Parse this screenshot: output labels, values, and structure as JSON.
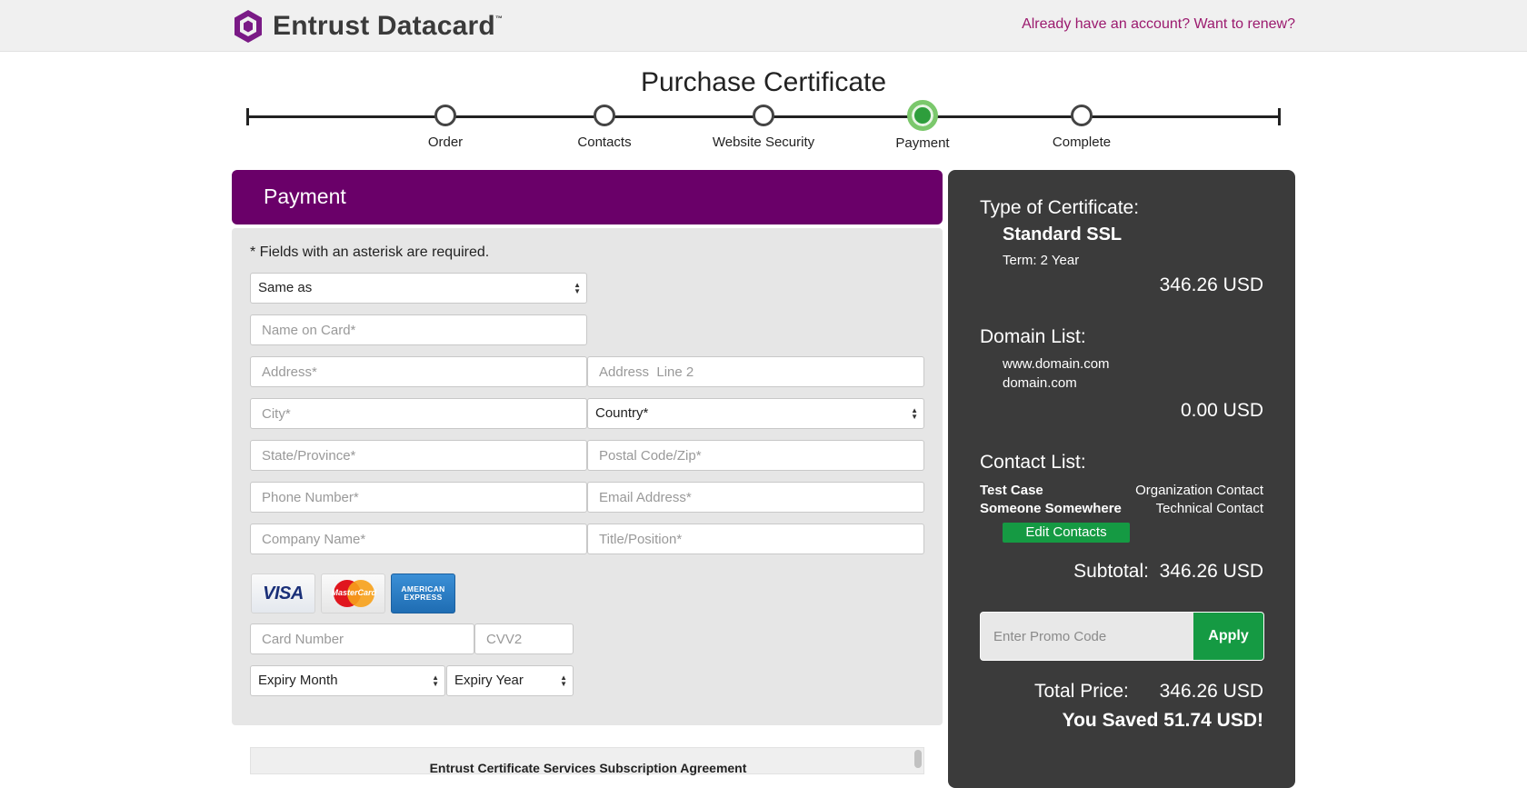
{
  "header": {
    "brand_name": "Entrust Datacard",
    "brand_tm": "™",
    "account_link": "Already have an account? Want to renew?"
  },
  "progress": {
    "title": "Purchase Certificate",
    "steps": [
      {
        "label": "Order",
        "state": "incomplete"
      },
      {
        "label": "Contacts",
        "state": "incomplete"
      },
      {
        "label": "Website Security",
        "state": "incomplete"
      },
      {
        "label": "Payment",
        "state": "active"
      },
      {
        "label": "Complete",
        "state": "incomplete"
      }
    ]
  },
  "payment": {
    "title": "Payment",
    "required_note": "* Fields with an asterisk are required.",
    "same_as_select": {
      "value": "Same as"
    },
    "fields": {
      "name_on_card": {
        "placeholder": "Name on Card*",
        "value": ""
      },
      "address": {
        "placeholder": "Address*",
        "value": ""
      },
      "address_line2": {
        "placeholder": "Address  Line 2",
        "value": ""
      },
      "city": {
        "placeholder": "City*",
        "value": ""
      },
      "country": {
        "value": "Country*"
      },
      "state": {
        "placeholder": "State/Province*",
        "value": ""
      },
      "postal": {
        "placeholder": "Postal Code/Zip*",
        "value": ""
      },
      "phone": {
        "placeholder": "Phone Number*",
        "value": ""
      },
      "email": {
        "placeholder": "Email Address*",
        "value": ""
      },
      "company": {
        "placeholder": "Company Name*",
        "value": ""
      },
      "title": {
        "placeholder": "Title/Position*",
        "value": ""
      },
      "card_number": {
        "placeholder": "Card Number",
        "value": ""
      },
      "cvv2": {
        "placeholder": "CVV2",
        "value": ""
      },
      "expiry_month": {
        "value": "Expiry Month"
      },
      "expiry_year": {
        "value": "Expiry Year"
      }
    },
    "card_logos": {
      "visa": "VISA",
      "mastercard": "MasterCard",
      "amex_line1": "AMERICAN",
      "amex_line2": "EXPRESS"
    },
    "agreement_title": "Entrust Certificate Services Subscription Agreement"
  },
  "summary": {
    "type_heading": "Type of Certificate:",
    "cert_name": "Standard SSL",
    "term": "Term: 2 Year",
    "cert_price": "346.26 USD",
    "domain_heading": "Domain List:",
    "domains": [
      "www.domain.com",
      "domain.com"
    ],
    "domain_price": "0.00 USD",
    "contact_heading": "Contact List:",
    "contacts": [
      {
        "name": "Test Case",
        "role": "Organization Contact"
      },
      {
        "name": "Someone Somewhere",
        "role": "Technical Contact"
      }
    ],
    "edit_contacts_label": "Edit Contacts",
    "subtotal_label": "Subtotal:",
    "subtotal_value": "346.26 USD",
    "promo_placeholder": "Enter Promo Code",
    "apply_label": "Apply",
    "total_label": "Total Price:",
    "total_value": "346.26 USD",
    "saved_text": "You Saved 51.74 USD!"
  },
  "colors": {
    "brand_purple": "#6a0069",
    "link_magenta": "#9b1a6e",
    "summary_bg": "#3b3b3b",
    "action_green": "#159a43",
    "active_step_green": "#7bc86c"
  }
}
